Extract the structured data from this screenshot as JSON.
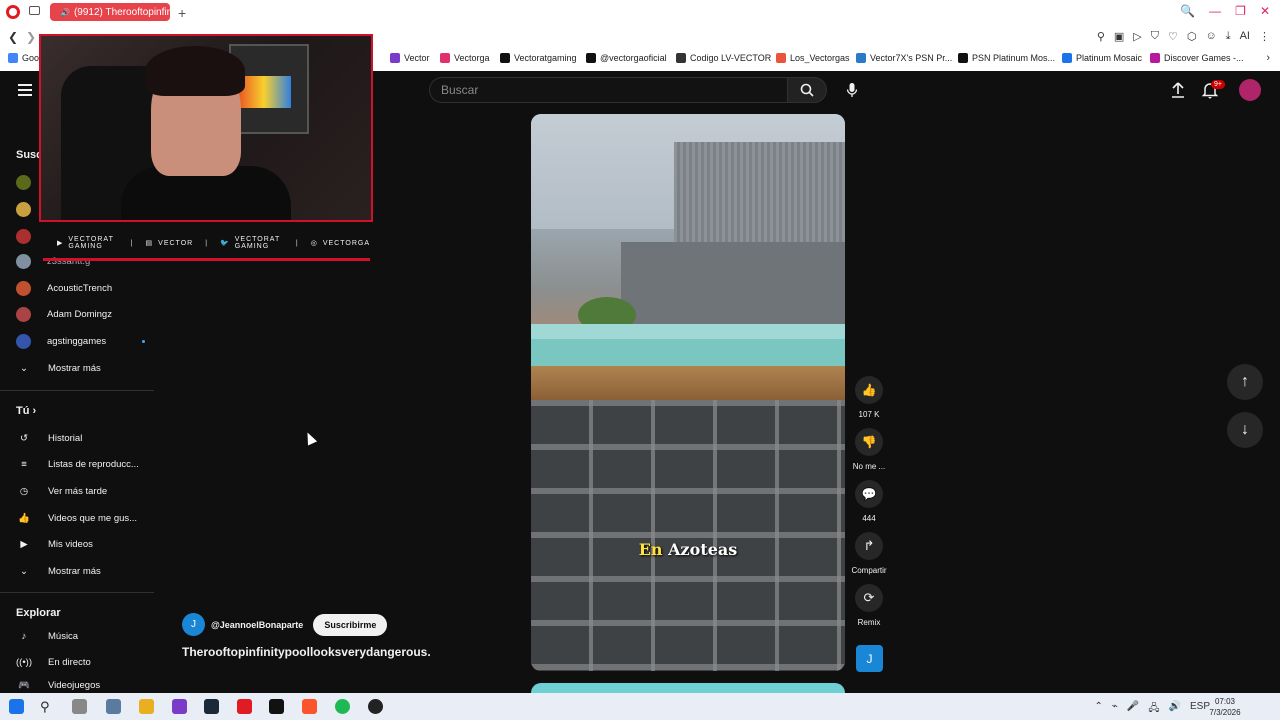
{
  "browser": {
    "tab_title": "(9912) Therooftopinfini",
    "new_tab_symbol": "+",
    "window_controls": [
      "🔍",
      "—",
      "❐",
      "✕"
    ],
    "bookmarks": [
      {
        "label": "Goog",
        "color": "#4285f4"
      },
      {
        "label": "Vector",
        "color": "#7a3cc8"
      },
      {
        "label": "Vectorga",
        "color": "#e1306c"
      },
      {
        "label": "Vectoratgaming",
        "color": "#111111"
      },
      {
        "label": "@vectorgaoficial",
        "color": "#111111"
      },
      {
        "label": "Codigo LV-VECTOR",
        "color": "#333333"
      },
      {
        "label": "Los_Vectorgas",
        "color": "#e8553a"
      },
      {
        "label": "Vector7X's PSN Pr...",
        "color": "#2a7ac8"
      },
      {
        "label": "PSN Platinum Mos...",
        "color": "#111111"
      },
      {
        "label": "Platinum Mosaic",
        "color": "#1a73e8"
      },
      {
        "label": "Discover Games -...",
        "color": "#b5179e"
      }
    ]
  },
  "youtube": {
    "search_placeholder": "Buscar",
    "notifications_badge": "9+",
    "sidebar": {
      "subs_title": "Susc",
      "subscriptions": [
        {
          "label": "AcousticTrench",
          "color": "#c05030"
        },
        {
          "label": "Adam Domingz",
          "color": "#aa4444"
        },
        {
          "label": "agstinggames",
          "color": "#3355aa",
          "live": true
        }
      ],
      "partial_label": "z3ssantt.g",
      "show_more": "Mostrar más",
      "you_title": "Tú",
      "you_items": [
        "Historial",
        "Listas de reproducc...",
        "Ver más tarde",
        "Videos que me gus...",
        "Mis videos"
      ],
      "you_show_more": "Mostrar más",
      "explore_title": "Explorar",
      "explore_items": [
        "Música",
        "En directo",
        "Videojuegos"
      ]
    },
    "short": {
      "caption_word1": "En",
      "caption_word2": "Azoteas",
      "channel_handle": "@JeannoelBonaparte",
      "channel_initial": "J",
      "subscribe_label": "Suscribirme",
      "title": "Therooftopinfinitypoollooksverydangerous."
    },
    "actions": {
      "likes": "107 K",
      "dislike": "No me ...",
      "comments": "444",
      "share": "Compartir",
      "remix": "Remix",
      "channel_initial": "J"
    }
  },
  "stream_overlay": {
    "socials": [
      {
        "icon": "youtube-icon",
        "label": "VECTORAT GAMING"
      },
      {
        "icon": "twitch-icon",
        "label": "VECTOR"
      },
      {
        "icon": "twitter-icon",
        "label": "VECTORAT GAMING"
      },
      {
        "icon": "instagram-icon",
        "label": "VECTORGA"
      }
    ],
    "accent": "#d2102a"
  },
  "taskbar": {
    "lang": "ESP",
    "time": "07:03",
    "date": "7/3/2026"
  }
}
